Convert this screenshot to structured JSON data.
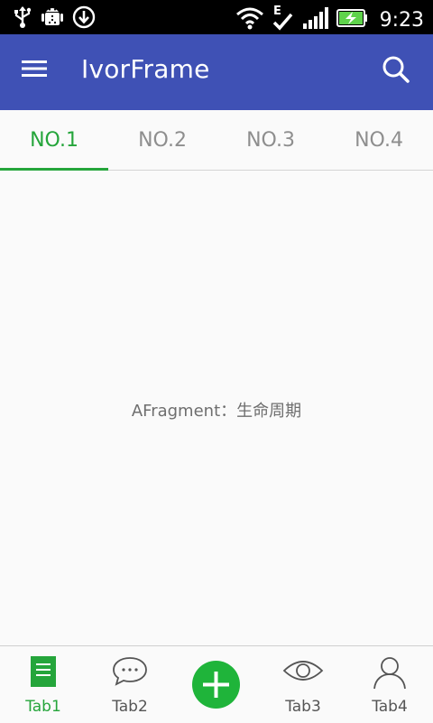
{
  "status_bar": {
    "time": "9:23",
    "icons": [
      "usb-icon",
      "android-debug-icon",
      "download-icon",
      "wifi-icon",
      "signal-e-icon",
      "cell-signal-icon",
      "battery-charging-icon"
    ]
  },
  "app_bar": {
    "title": "IvorFrame",
    "menu_icon": "hamburger-menu-icon",
    "search_icon": "search-icon",
    "color": "#3f51b5"
  },
  "top_tabs": {
    "active_index": 0,
    "active_color": "#25a53b",
    "items": [
      {
        "label": "NO.1"
      },
      {
        "label": "NO.2"
      },
      {
        "label": "NO.3"
      },
      {
        "label": "NO.4"
      }
    ]
  },
  "content": {
    "text": "AFragment：生命周期"
  },
  "bottom_nav": {
    "active_index": 0,
    "items": [
      {
        "label": "Tab1",
        "icon": "document-icon"
      },
      {
        "label": "Tab2",
        "icon": "chat-bubble-icon"
      },
      {
        "label": "",
        "icon": "add-circle-icon"
      },
      {
        "label": "Tab3",
        "icon": "eye-icon"
      },
      {
        "label": "Tab4",
        "icon": "person-icon"
      }
    ]
  }
}
